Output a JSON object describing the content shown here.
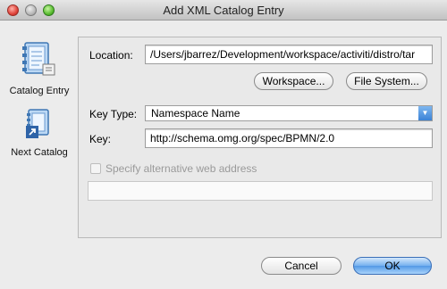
{
  "window": {
    "title": "Add XML Catalog Entry"
  },
  "sidebar": {
    "items": [
      {
        "label": "Catalog Entry",
        "icon": "catalog-entry-icon"
      },
      {
        "label": "Next Catalog",
        "icon": "next-catalog-icon"
      }
    ]
  },
  "form": {
    "location_label": "Location:",
    "location_value": "/Users/jbarrez/Development/workspace/activiti/distro/tar",
    "workspace_button": "Workspace...",
    "filesystem_button": "File System...",
    "key_type_label": "Key Type:",
    "key_type_value": "Namespace Name",
    "key_label": "Key:",
    "key_value": "http://schema.omg.org/spec/BPMN/2.0",
    "alt_web_address_label": "Specify alternative web address",
    "alt_web_address_value": ""
  },
  "footer": {
    "cancel_label": "Cancel",
    "ok_label": "OK"
  },
  "colors": {
    "accent": "#3b82d6",
    "window_bg": "#ececec"
  }
}
